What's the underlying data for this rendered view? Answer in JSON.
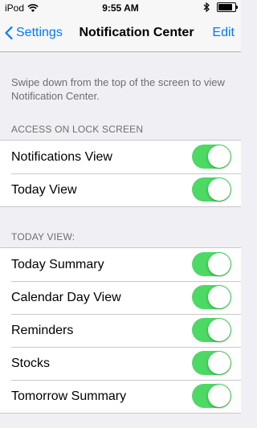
{
  "status_bar": {
    "carrier": "iPod",
    "time": "9:55 AM",
    "icons": [
      "wifi-icon",
      "bluetooth-icon",
      "battery-icon"
    ]
  },
  "nav": {
    "back_label": "Settings",
    "title": "Notification Center",
    "edit_label": "Edit"
  },
  "intro_text": "Swipe down from the top of the screen to view Notification Center.",
  "lock_screen": {
    "header": "ACCESS ON LOCK SCREEN",
    "items": [
      {
        "label": "Notifications View",
        "on": true
      },
      {
        "label": "Today View",
        "on": true
      }
    ]
  },
  "today_view": {
    "header": "TODAY VIEW:",
    "items": [
      {
        "label": "Today Summary",
        "on": true
      },
      {
        "label": "Calendar Day View",
        "on": true
      },
      {
        "label": "Reminders",
        "on": true
      },
      {
        "label": "Stocks",
        "on": true
      },
      {
        "label": "Tomorrow Summary",
        "on": true
      }
    ]
  },
  "colors": {
    "accent": "#007aff",
    "toggle_on": "#4cd964",
    "background": "#efeff4"
  }
}
